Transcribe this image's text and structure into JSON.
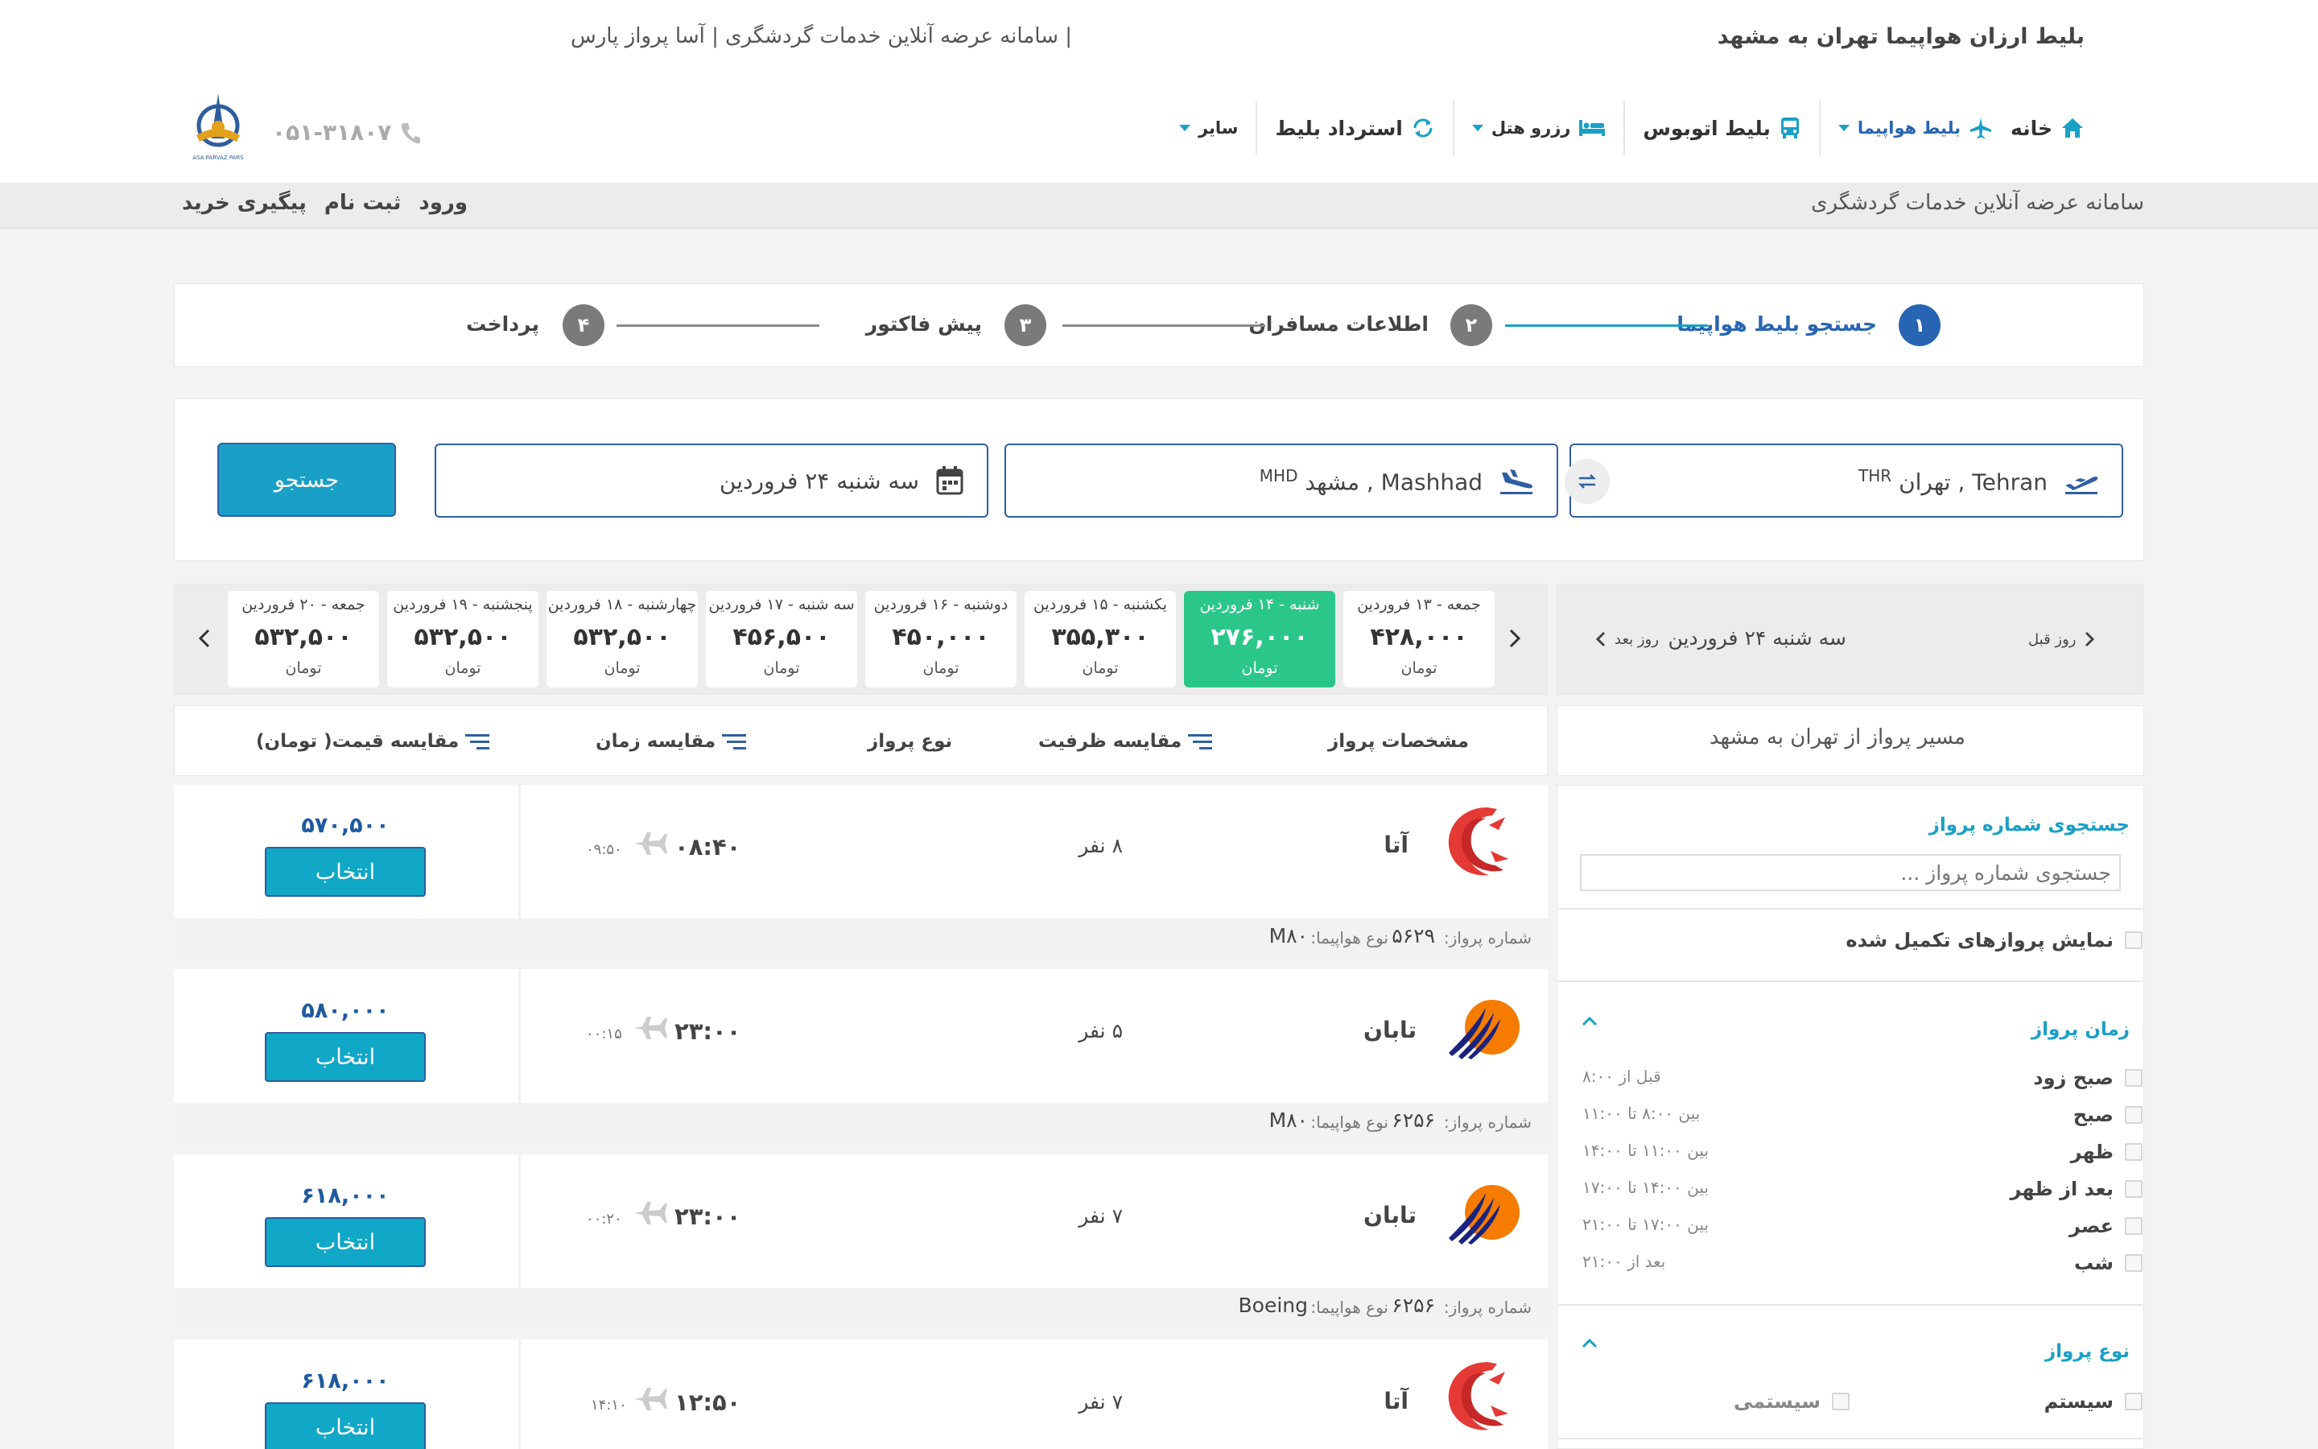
{
  "header": {
    "headline": "بلیط ارزان هواپیما تهران به مشهد",
    "brand_line": "| سامانه عرضه آنلاین خدمات گردشگری  |  آسا پرواز پارس",
    "phone": "۰۵۱-۳۱۸۰۷",
    "logo_text": "ASA PARVAZ PARS",
    "nav": {
      "home": "خانه",
      "flight": "بلیط هواپیما",
      "bus": "بلیط اتوبوس",
      "hotel": "رزرو هتل",
      "refund": "استرداد بلیط",
      "other": "سایر"
    },
    "subbar_title": "سامانه عرضه آنلاین خدمات گردشگری",
    "login": "ورود",
    "register": "ثبت نام",
    "track": "پیگیری خرید"
  },
  "steps": [
    {
      "num": "۱",
      "label": "جستجو بلیط هواپیما"
    },
    {
      "num": "۲",
      "label": "اطلاعات مسافران"
    },
    {
      "num": "۳",
      "label": "پیش فاکتور"
    },
    {
      "num": "۴",
      "label": "پرداخت"
    }
  ],
  "search": {
    "origin": "Tehran , تهران",
    "origin_code": "THR",
    "destination": "Mashhad , مشهد",
    "destination_code": "MHD",
    "date": "سه شنبه ۲۴ فروردین",
    "button": "جستجو"
  },
  "day_nav": {
    "prev": "روز قبل",
    "next": "روز بعد",
    "current": "سه شنبه ۲۴ فروردین"
  },
  "days": [
    {
      "date": "جمعه - ۱۳ فروردین",
      "price": "۴۲۸,۰۰۰",
      "unit": "تومان"
    },
    {
      "date": "شنبه - ۱۴ فروردین",
      "price": "۲۷۶,۰۰۰",
      "unit": "تومان"
    },
    {
      "date": "یکشنبه - ۱۵ فروردین",
      "price": "۳۵۵,۳۰۰",
      "unit": "تومان"
    },
    {
      "date": "دوشنبه - ۱۶ فروردین",
      "price": "۴۵۰,۰۰۰",
      "unit": "تومان"
    },
    {
      "date": "سه شنبه - ۱۷ فروردین",
      "price": "۴۵۶,۵۰۰",
      "unit": "تومان"
    },
    {
      "date": "چهارشنبه - ۱۸ فروردین",
      "price": "۵۳۲,۵۰۰",
      "unit": "تومان"
    },
    {
      "date": "پنجشنبه - ۱۹ فروردین",
      "price": "۵۳۲,۵۰۰",
      "unit": "تومان"
    },
    {
      "date": "جمعه - ۲۰ فروردین",
      "price": "۵۳۲,۵۰۰",
      "unit": "تومان"
    }
  ],
  "columns": {
    "details": "مشخصات پرواز",
    "capacity": "مقایسه ظرفیت",
    "flight_type": "نوع پرواز",
    "time": "مقایسه زمان",
    "price": "مقایسه قیمت( تومان)"
  },
  "route_title": "مسیر پرواز از تهران به مشهد",
  "result_labels": {
    "flight_no": "شماره پرواز:",
    "aircraft": "نوع هواپیما:",
    "select": "انتخاب"
  },
  "results": [
    {
      "airline": "آتا",
      "logo": "ata-logo",
      "capacity": "۸ نفر",
      "dep": "۰۸:۴۰",
      "arr": "۰۹:۵۰",
      "price": "۵۷۰,۵۰۰",
      "flight_no": "۵۶۲۹",
      "aircraft": "M۸۰"
    },
    {
      "airline": "تابان",
      "logo": "taban-logo",
      "capacity": "۵ نفر",
      "dep": "۲۳:۰۰",
      "arr": "۰۰:۱۵",
      "price": "۵۸۰,۰۰۰",
      "flight_no": "۶۲۵۶",
      "aircraft": "M۸۰"
    },
    {
      "airline": "تابان",
      "logo": "taban-logo",
      "capacity": "۷ نفر",
      "dep": "۲۳:۰۰",
      "arr": "۰۰:۲۰",
      "price": "۶۱۸,۰۰۰",
      "flight_no": "۶۲۵۶",
      "aircraft": "Boeing"
    },
    {
      "airline": "آتا",
      "logo": "ata-logo",
      "capacity": "۷ نفر",
      "dep": "۱۲:۵۰",
      "arr": "۱۴:۱۰",
      "price": "۶۱۸,۰۰۰",
      "flight_no": "",
      "aircraft": ""
    }
  ],
  "filters": {
    "flight_no_title": "جستجوی شماره پرواز",
    "flight_no_placeholder": "جستجوی شماره پرواز ...",
    "show_full": "نمایش پروازهای تکمیل شده",
    "time_title": "زمان پرواز",
    "times": [
      {
        "label": "صبح زود",
        "range": "قبل از ۸:۰۰"
      },
      {
        "label": "صبح",
        "range": "بین ۸:۰۰ تا ۱۱:۰۰"
      },
      {
        "label": "ظهر",
        "range": "بین ۱۱:۰۰ تا ۱۴:۰۰"
      },
      {
        "label": "بعد از ظهر",
        "range": "بین ۱۴:۰۰ تا ۱۷:۰۰"
      },
      {
        "label": "عصر",
        "range": "بین ۱۷:۰۰ تا ۲۱:۰۰"
      },
      {
        "label": "شب",
        "range": "بعد از ۲۱:۰۰"
      }
    ],
    "type_title": "نوع پرواز",
    "types": [
      "سیستم",
      "سیستمی"
    ]
  },
  "colors": {
    "accent": "#1aa0c7",
    "primary": "#2765b2",
    "active_day": "#2bc78a",
    "price": "#1f5aa0"
  }
}
